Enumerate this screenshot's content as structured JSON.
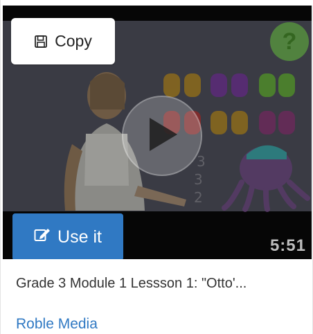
{
  "card": {
    "copy_label": "Copy",
    "help_label": "?",
    "use_it_label": "Use it",
    "duration": "5:51",
    "title": "Grade 3 Module 1 Lessson 1: \"Otto'...",
    "author": "Roble Media"
  },
  "colors": {
    "accent": "#3079c3",
    "help_badge": "#64be3c",
    "video_background": "#060606"
  },
  "icons": {
    "copy": "floppy-disk-icon",
    "use_it": "edit-pencil-icon",
    "play": "play-icon",
    "help": "question-mark-icon"
  }
}
